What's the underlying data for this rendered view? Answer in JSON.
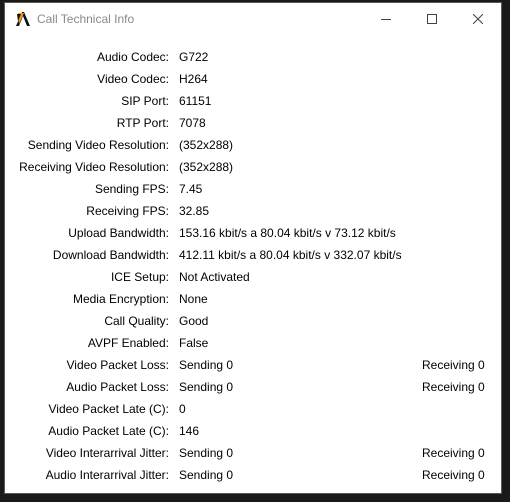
{
  "window": {
    "title": "Call Technical Info",
    "icons": {
      "app": "app-logo-icon",
      "minimize": "minimize-icon",
      "maximize": "maximize-icon",
      "close": "close-icon"
    }
  },
  "rows": [
    {
      "label": "Audio Codec:",
      "value": "G722",
      "value2": ""
    },
    {
      "label": "Video Codec:",
      "value": "H264",
      "value2": ""
    },
    {
      "label": "SIP Port:",
      "value": "61151",
      "value2": ""
    },
    {
      "label": "RTP Port:",
      "value": "7078",
      "value2": ""
    },
    {
      "label": "Sending Video Resolution:",
      "value": "(352x288)",
      "value2": ""
    },
    {
      "label": "Receiving Video Resolution:",
      "value": "(352x288)",
      "value2": ""
    },
    {
      "label": "Sending FPS:",
      "value": "7.45",
      "value2": ""
    },
    {
      "label": "Receiving FPS:",
      "value": "32.85",
      "value2": ""
    },
    {
      "label": "Upload Bandwidth:",
      "value": "153.16 kbit/s a 80.04 kbit/s v 73.12 kbit/s",
      "value2": ""
    },
    {
      "label": "Download Bandwidth:",
      "value": "412.11 kbit/s a 80.04 kbit/s v 332.07 kbit/s",
      "value2": ""
    },
    {
      "label": "ICE Setup:",
      "value": "Not Activated",
      "value2": ""
    },
    {
      "label": "Media Encryption:",
      "value": "None",
      "value2": ""
    },
    {
      "label": "Call Quality:",
      "value": "Good",
      "value2": ""
    },
    {
      "label": "AVPF Enabled:",
      "value": "False",
      "value2": ""
    },
    {
      "label": "Video Packet Loss:",
      "value": "Sending 0",
      "value2": "Receiving 0"
    },
    {
      "label": "Audio Packet Loss:",
      "value": "Sending 0",
      "value2": "Receiving 0"
    },
    {
      "label": "Video Packet Late (C):",
      "value": "0",
      "value2": ""
    },
    {
      "label": "Audio Packet Late (C):",
      "value": "146",
      "value2": ""
    },
    {
      "label": "Video Interarrival Jitter:",
      "value": "Sending 0",
      "value2": "Receiving 0"
    },
    {
      "label": "Audio Interarrival Jitter:",
      "value": "Sending 0",
      "value2": "Receiving 0"
    }
  ]
}
